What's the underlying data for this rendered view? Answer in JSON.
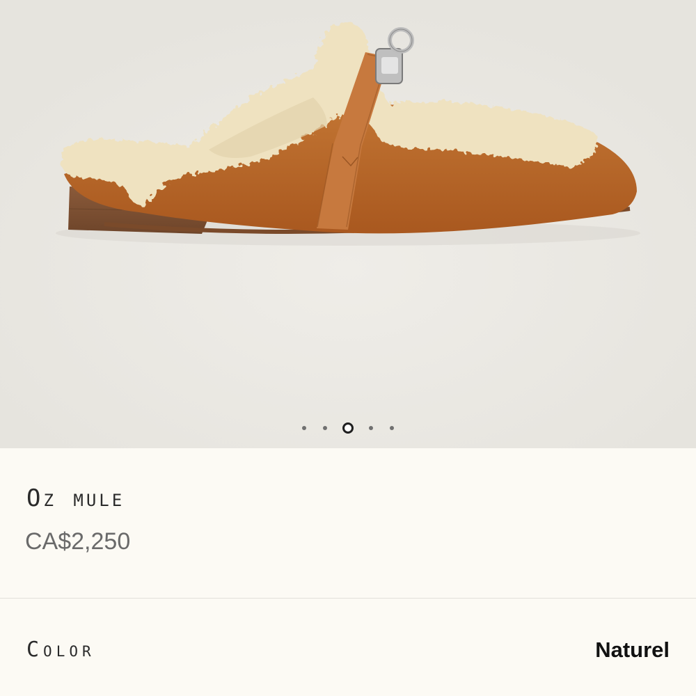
{
  "gallery": {
    "image": "oz-mule-shearling-suede",
    "slide_count": 5,
    "active_slide": 3
  },
  "product": {
    "name": "Oz mule",
    "price": "CA$2,250"
  },
  "color": {
    "label": "Color",
    "value": "Naturel"
  },
  "colors": {
    "page_bg": "#fcfaf4",
    "gallery_bg": "#ebe9e3",
    "suede": "#b8692a",
    "shearling": "#efe2c0",
    "strap": "#c7793e",
    "hardware": "#c8c8c8"
  }
}
